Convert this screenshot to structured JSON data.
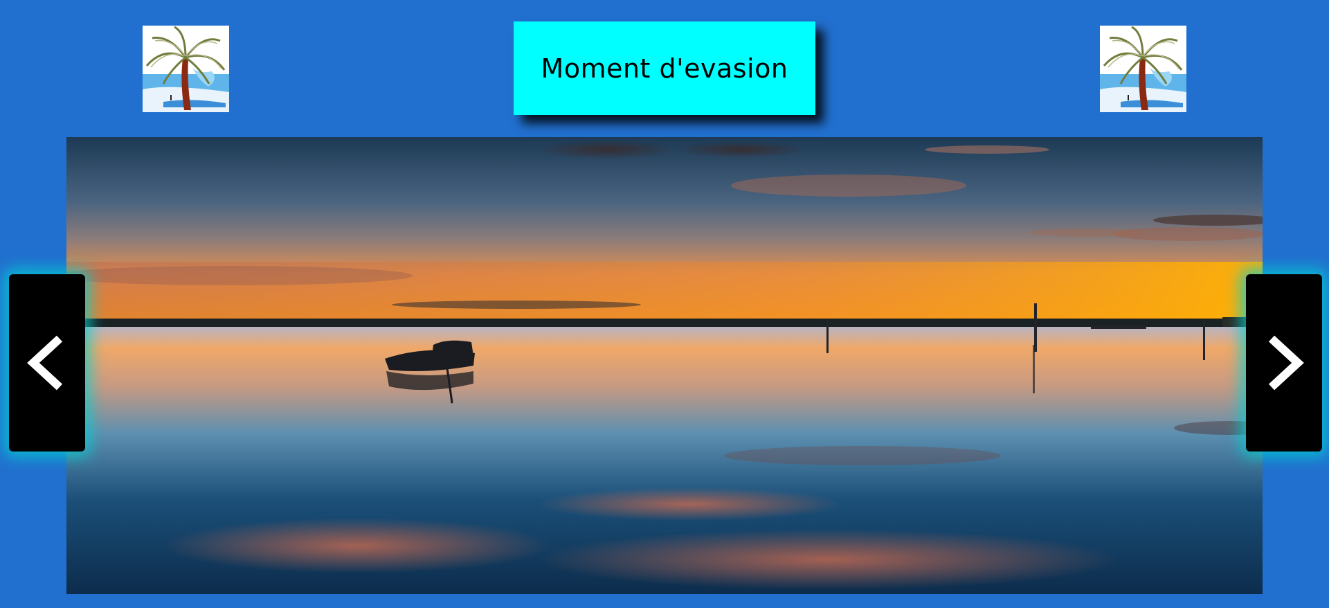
{
  "header": {
    "title": "Moment d'evasion"
  },
  "decorations": {
    "left_icon": "palm-tree-beach-icon",
    "right_icon": "palm-tree-beach-icon"
  },
  "slider": {
    "image_subject": "sunset-lake-boat-image",
    "prev_icon": "chevron-left-icon",
    "next_icon": "chevron-right-icon"
  },
  "colors": {
    "background": "#2170cf",
    "title_box": "#00ffff",
    "nav_button": "#000000",
    "nav_glow": "#00d2d2"
  }
}
